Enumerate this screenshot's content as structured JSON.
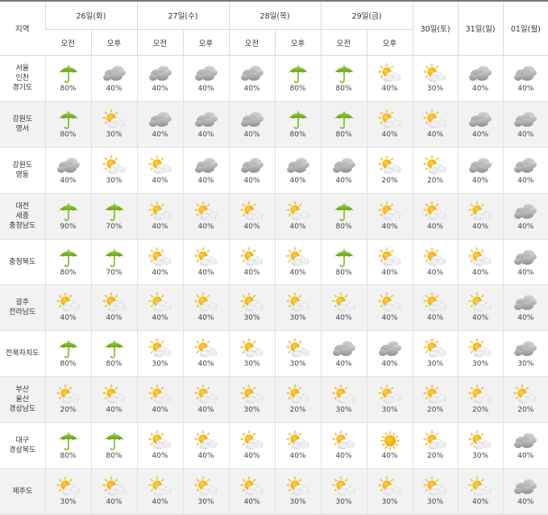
{
  "header": {
    "region_label": "지역",
    "days_split": [
      {
        "label": "26일(화)",
        "am": "오전",
        "pm": "오후"
      },
      {
        "label": "27일(수)",
        "am": "오전",
        "pm": "오후"
      },
      {
        "label": "28일(목)",
        "am": "오전",
        "pm": "오후"
      },
      {
        "label": "29일(금)",
        "am": "오전",
        "pm": "오후"
      }
    ],
    "days_single": [
      {
        "label": "30일(토)"
      },
      {
        "label": "31일(일)"
      },
      {
        "label": "01일(월)"
      }
    ]
  },
  "legend": {
    "rain": "umbrella-icon",
    "cloudy": "cloud-icon",
    "partly_cloudy": "sun-behind-cloud-icon",
    "sunny": "sun-icon"
  },
  "colors": {
    "umbrella": "#7dba1e",
    "cloud": "#a9a9a9",
    "sun": "#f5b301",
    "shaded_row": "#f2f2f2",
    "header_top_border": "#777777"
  },
  "rows": [
    {
      "region": [
        "서울",
        "인천",
        "경기도"
      ],
      "cells": [
        {
          "icon": "rain",
          "pop": "80%"
        },
        {
          "icon": "cloudy",
          "pop": "40%"
        },
        {
          "icon": "cloudy",
          "pop": "40%"
        },
        {
          "icon": "cloudy",
          "pop": "40%"
        },
        {
          "icon": "cloudy",
          "pop": "40%"
        },
        {
          "icon": "rain",
          "pop": "80%"
        },
        {
          "icon": "rain",
          "pop": "80%"
        },
        {
          "icon": "partly_cloudy",
          "pop": "40%"
        },
        {
          "icon": "partly_cloudy",
          "pop": "30%"
        },
        {
          "icon": "cloudy",
          "pop": "40%"
        },
        {
          "icon": "cloudy",
          "pop": "40%"
        }
      ]
    },
    {
      "region": [
        "강원도",
        "영서"
      ],
      "cells": [
        {
          "icon": "rain",
          "pop": "80%"
        },
        {
          "icon": "partly_cloudy",
          "pop": "30%"
        },
        {
          "icon": "cloudy",
          "pop": "40%"
        },
        {
          "icon": "cloudy",
          "pop": "40%"
        },
        {
          "icon": "cloudy",
          "pop": "40%"
        },
        {
          "icon": "rain",
          "pop": "80%"
        },
        {
          "icon": "rain",
          "pop": "80%"
        },
        {
          "icon": "partly_cloudy",
          "pop": "40%"
        },
        {
          "icon": "partly_cloudy",
          "pop": "40%"
        },
        {
          "icon": "cloudy",
          "pop": "40%"
        },
        {
          "icon": "cloudy",
          "pop": "40%"
        }
      ]
    },
    {
      "region": [
        "강원도",
        "영동"
      ],
      "cells": [
        {
          "icon": "cloudy",
          "pop": "40%"
        },
        {
          "icon": "partly_cloudy",
          "pop": "30%"
        },
        {
          "icon": "partly_cloudy",
          "pop": "40%"
        },
        {
          "icon": "cloudy",
          "pop": "40%"
        },
        {
          "icon": "cloudy",
          "pop": "40%"
        },
        {
          "icon": "cloudy",
          "pop": "40%"
        },
        {
          "icon": "cloudy",
          "pop": "40%"
        },
        {
          "icon": "partly_cloudy",
          "pop": "20%"
        },
        {
          "icon": "partly_cloudy",
          "pop": "20%"
        },
        {
          "icon": "cloudy",
          "pop": "40%"
        },
        {
          "icon": "cloudy",
          "pop": "40%"
        }
      ]
    },
    {
      "region": [
        "대전",
        "세종",
        "충청남도"
      ],
      "cells": [
        {
          "icon": "rain",
          "pop": "90%"
        },
        {
          "icon": "rain",
          "pop": "70%"
        },
        {
          "icon": "partly_cloudy",
          "pop": "40%"
        },
        {
          "icon": "partly_cloudy",
          "pop": "40%"
        },
        {
          "icon": "partly_cloudy",
          "pop": "40%"
        },
        {
          "icon": "partly_cloudy",
          "pop": "40%"
        },
        {
          "icon": "rain",
          "pop": "80%"
        },
        {
          "icon": "partly_cloudy",
          "pop": "40%"
        },
        {
          "icon": "partly_cloudy",
          "pop": "40%"
        },
        {
          "icon": "partly_cloudy",
          "pop": "40%"
        },
        {
          "icon": "cloudy",
          "pop": "40%"
        }
      ]
    },
    {
      "region": [
        "충청북도"
      ],
      "cells": [
        {
          "icon": "rain",
          "pop": "80%"
        },
        {
          "icon": "rain",
          "pop": "70%"
        },
        {
          "icon": "partly_cloudy",
          "pop": "40%"
        },
        {
          "icon": "partly_cloudy",
          "pop": "40%"
        },
        {
          "icon": "partly_cloudy",
          "pop": "40%"
        },
        {
          "icon": "partly_cloudy",
          "pop": "40%"
        },
        {
          "icon": "rain",
          "pop": "80%"
        },
        {
          "icon": "partly_cloudy",
          "pop": "40%"
        },
        {
          "icon": "partly_cloudy",
          "pop": "40%"
        },
        {
          "icon": "partly_cloudy",
          "pop": "40%"
        },
        {
          "icon": "cloudy",
          "pop": "40%"
        }
      ]
    },
    {
      "region": [
        "광주",
        "전라남도"
      ],
      "cells": [
        {
          "icon": "partly_cloudy",
          "pop": "40%"
        },
        {
          "icon": "partly_cloudy",
          "pop": "40%"
        },
        {
          "icon": "partly_cloudy",
          "pop": "40%"
        },
        {
          "icon": "partly_cloudy",
          "pop": "40%"
        },
        {
          "icon": "partly_cloudy",
          "pop": "30%"
        },
        {
          "icon": "partly_cloudy",
          "pop": "30%"
        },
        {
          "icon": "partly_cloudy",
          "pop": "40%"
        },
        {
          "icon": "partly_cloudy",
          "pop": "40%"
        },
        {
          "icon": "partly_cloudy",
          "pop": "40%"
        },
        {
          "icon": "partly_cloudy",
          "pop": "40%"
        },
        {
          "icon": "cloudy",
          "pop": "40%"
        }
      ]
    },
    {
      "region": [
        "전북자치도"
      ],
      "cells": [
        {
          "icon": "rain",
          "pop": "80%"
        },
        {
          "icon": "rain",
          "pop": "80%"
        },
        {
          "icon": "partly_cloudy",
          "pop": "30%"
        },
        {
          "icon": "partly_cloudy",
          "pop": "40%"
        },
        {
          "icon": "partly_cloudy",
          "pop": "30%"
        },
        {
          "icon": "partly_cloudy",
          "pop": "30%"
        },
        {
          "icon": "cloudy",
          "pop": "40%"
        },
        {
          "icon": "cloudy",
          "pop": "40%"
        },
        {
          "icon": "partly_cloudy",
          "pop": "30%"
        },
        {
          "icon": "partly_cloudy",
          "pop": "30%"
        },
        {
          "icon": "cloudy",
          "pop": "30%"
        }
      ]
    },
    {
      "region": [
        "부산",
        "울산",
        "경상남도"
      ],
      "cells": [
        {
          "icon": "partly_cloudy",
          "pop": "20%"
        },
        {
          "icon": "partly_cloudy",
          "pop": "40%"
        },
        {
          "icon": "partly_cloudy",
          "pop": "40%"
        },
        {
          "icon": "partly_cloudy",
          "pop": "40%"
        },
        {
          "icon": "partly_cloudy",
          "pop": "30%"
        },
        {
          "icon": "partly_cloudy",
          "pop": "20%"
        },
        {
          "icon": "partly_cloudy",
          "pop": "30%"
        },
        {
          "icon": "partly_cloudy",
          "pop": "30%"
        },
        {
          "icon": "partly_cloudy",
          "pop": "20%"
        },
        {
          "icon": "partly_cloudy",
          "pop": "20%"
        },
        {
          "icon": "partly_cloudy",
          "pop": "20%"
        }
      ]
    },
    {
      "region": [
        "대구",
        "경상북도"
      ],
      "cells": [
        {
          "icon": "rain",
          "pop": "80%"
        },
        {
          "icon": "rain",
          "pop": "80%"
        },
        {
          "icon": "partly_cloudy",
          "pop": "40%"
        },
        {
          "icon": "partly_cloudy",
          "pop": "40%"
        },
        {
          "icon": "partly_cloudy",
          "pop": "40%"
        },
        {
          "icon": "partly_cloudy",
          "pop": "40%"
        },
        {
          "icon": "partly_cloudy",
          "pop": "40%"
        },
        {
          "icon": "sunny",
          "pop": "40%"
        },
        {
          "icon": "partly_cloudy",
          "pop": "20%"
        },
        {
          "icon": "partly_cloudy",
          "pop": "30%"
        },
        {
          "icon": "cloudy",
          "pop": "40%"
        }
      ]
    },
    {
      "region": [
        "제주도"
      ],
      "cells": [
        {
          "icon": "partly_cloudy",
          "pop": "30%"
        },
        {
          "icon": "partly_cloudy",
          "pop": "40%"
        },
        {
          "icon": "partly_cloudy",
          "pop": "40%"
        },
        {
          "icon": "partly_cloudy",
          "pop": "30%"
        },
        {
          "icon": "partly_cloudy",
          "pop": "40%"
        },
        {
          "icon": "partly_cloudy",
          "pop": "30%"
        },
        {
          "icon": "partly_cloudy",
          "pop": "30%"
        },
        {
          "icon": "partly_cloudy",
          "pop": "30%"
        },
        {
          "icon": "partly_cloudy",
          "pop": "30%"
        },
        {
          "icon": "partly_cloudy",
          "pop": "40%"
        },
        {
          "icon": "cloudy",
          "pop": "40%"
        }
      ]
    }
  ]
}
